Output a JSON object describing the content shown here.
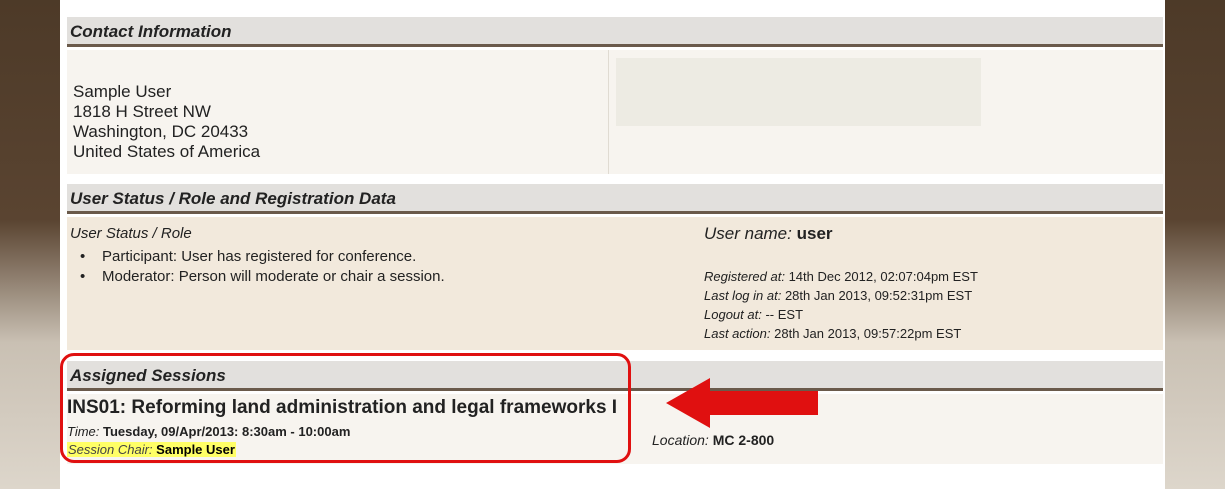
{
  "contact": {
    "header": "Contact Information",
    "name": "Sample User",
    "street": "1818 H Street NW",
    "city": "Washington, DC 20433",
    "country": "United States of America"
  },
  "status": {
    "header": "User Status / Role and Registration Data",
    "role_title": "User Status / Role",
    "roles": [
      "Participant: User has registered for conference.",
      "Moderator: Person will moderate or chair a session."
    ],
    "username_label": "User name:",
    "username": "user",
    "registered_label": "Registered at:",
    "registered_value": "14th Dec 2012, 02:07:04pm EST",
    "lastlogin_label": "Last log in at:",
    "lastlogin_value": "28th Jan 2013, 09:52:31pm EST",
    "logout_label": "Logout at:",
    "logout_value": "-- EST",
    "lastaction_label": "Last action:",
    "lastaction_value": "28th Jan 2013, 09:57:22pm EST"
  },
  "sessions": {
    "header": "Assigned Sessions",
    "title": "INS01: Reforming land administration and legal frameworks I",
    "time_label": "Time:",
    "time_value": "Tuesday, 09/Apr/2013: 8:30am - 10:00am",
    "chair_label": "Session Chair:",
    "chair_value": "Sample User",
    "location_label": "Location:",
    "location_value": "MC 2-800"
  },
  "colors": {
    "annotation": "#e01010",
    "header_bg": "#e2e0dd",
    "header_rule": "#6a5a4b",
    "highlight": "#ffff66"
  },
  "icons": {
    "arrow": "left-arrow-icon"
  }
}
